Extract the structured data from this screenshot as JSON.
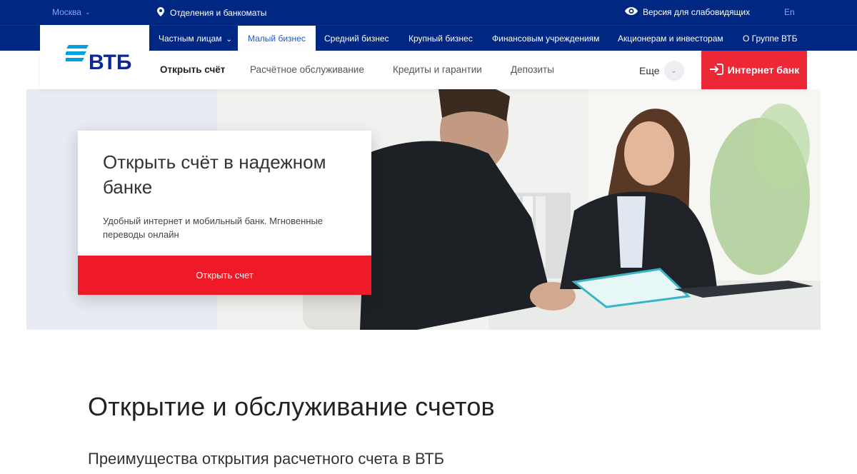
{
  "topbar": {
    "city": "Москва",
    "branches": "Отделения и банкоматы",
    "accessible": "Версия для слабовидящих",
    "lang": "En"
  },
  "segments": [
    {
      "label": "Частным лицам",
      "has_chevron": true
    },
    {
      "label": "Малый бизнес",
      "active": true
    },
    {
      "label": "Средний бизнес"
    },
    {
      "label": "Крупный бизнес"
    },
    {
      "label": "Финансовым учреждениям"
    },
    {
      "label": "Акционерам и инвесторам"
    },
    {
      "label": "О Группе ВТБ"
    }
  ],
  "logo": {
    "text": "ВТБ"
  },
  "subnav": {
    "items": [
      "Открыть счёт",
      "Расчётное обслуживание",
      "Кредиты и гарантии",
      "Депозиты"
    ],
    "more": "Еще"
  },
  "internet_bank": "Интернет банк",
  "hero_card": {
    "title": "Открыть счёт в надежном банке",
    "description": "Удобный интернет и мобильный банк. Мгновенные переводы онлайн",
    "button": "Открыть счет"
  },
  "content": {
    "heading": "Открытие и обслуживание счетов",
    "subheading": "Преимущества открытия расчетного счета в ВТБ"
  },
  "colors": {
    "brand_blue": "#002882",
    "accent_red": "#ee2737",
    "link_blue": "#1d57d6"
  },
  "icons": {
    "location": "location-pin-icon",
    "eye": "eye-icon",
    "login": "login-arrow-icon",
    "chevron": "chevron-down-icon"
  }
}
